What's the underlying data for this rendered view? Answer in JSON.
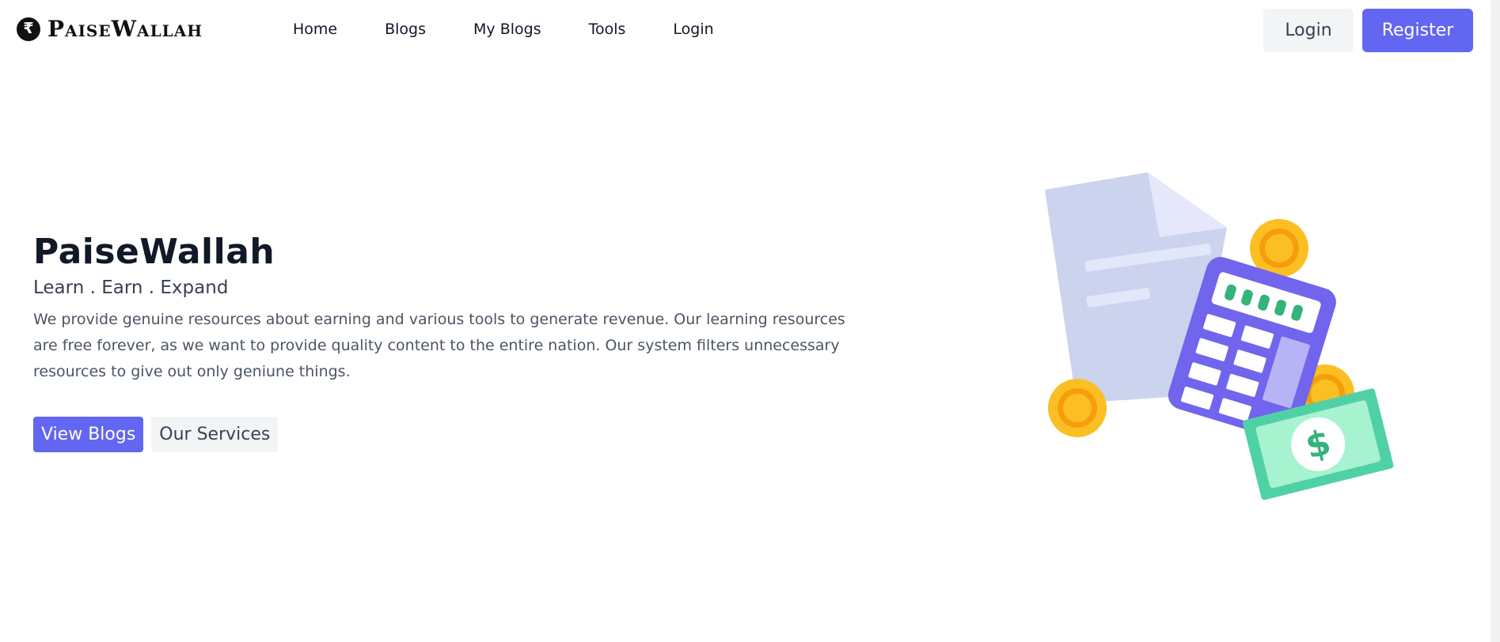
{
  "brand": {
    "name": "PaiseWallah",
    "icon": "rupee-icon"
  },
  "nav": {
    "links": [
      {
        "label": "Home"
      },
      {
        "label": "Blogs"
      },
      {
        "label": "My Blogs"
      },
      {
        "label": "Tools"
      },
      {
        "label": "Login"
      }
    ],
    "login_button": "Login",
    "register_button": "Register"
  },
  "hero": {
    "title": "PaiseWallah",
    "subtitle": "Learn . Earn . Expand",
    "description": "We provide genuine resources about earning and various tools to generate revenue. Our learning resources are free forever, as we want to provide quality content to the entire nation. Our system filters unnecessary resources to give out only geniune things.",
    "primary_button": "View Blogs",
    "secondary_button": "Our Services"
  },
  "illustration": {
    "icon": "finance-calculator-illustration",
    "money_symbol": "$"
  },
  "colors": {
    "accent": "#6366f1",
    "secondary_bg": "#f3f4f6",
    "paper": "#ccd3ee",
    "coin": "#fbbf24",
    "coin_ring": "#f59e0b",
    "bill": "#4ade80"
  }
}
